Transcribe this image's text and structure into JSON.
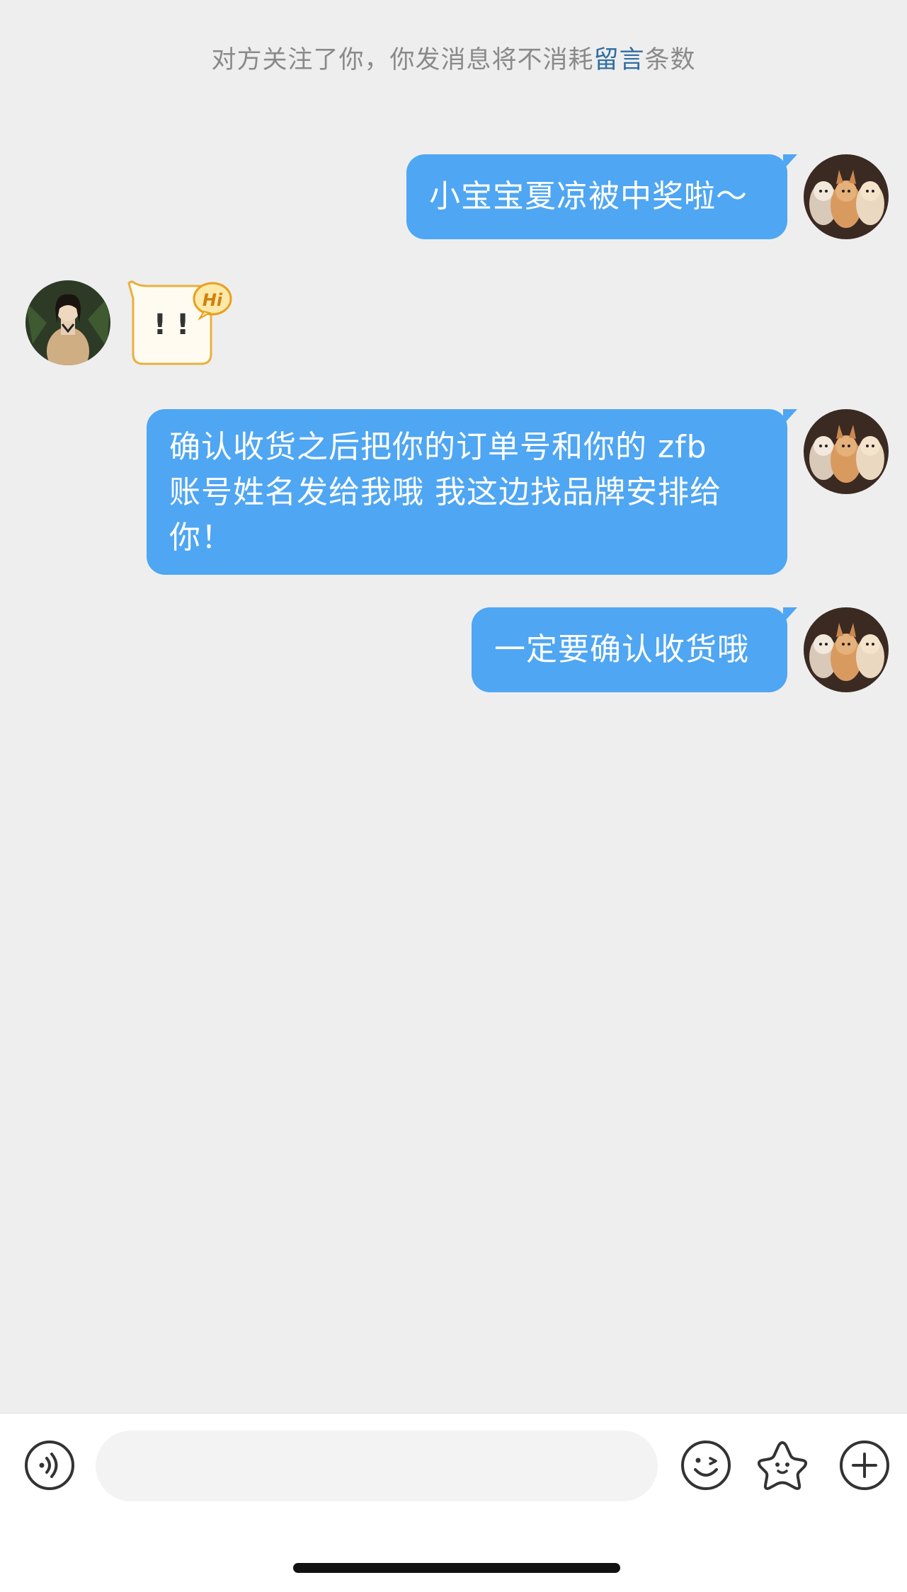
{
  "notice": {
    "prefix": "对方关注了你，你发消息将不消耗",
    "link": "留言",
    "suffix": "条数"
  },
  "messages": [
    {
      "side": "outgoing",
      "text": "小宝宝夏凉被中奖啦～"
    },
    {
      "side": "incoming",
      "sticker_text": "! !",
      "badge": "Hi"
    },
    {
      "side": "outgoing",
      "lines": [
        "确认收货之后把你的订单号和你的 zfb",
        "账号姓名发给我哦 我这边找品牌安排给",
        "你！"
      ]
    },
    {
      "side": "outgoing",
      "text": "一定要确认收货哦"
    }
  ],
  "input_bar": {
    "placeholder": "",
    "icons": [
      "voice-icon",
      "emoji-icon",
      "sticker-star-icon",
      "plus-icon"
    ]
  },
  "colors": {
    "background": "#eeeeee",
    "outgoing_bubble": "#4fa6f2",
    "notice_text": "#8a8a8a",
    "notice_link": "#2f6ea3",
    "sticker_fill": "#fffbf0",
    "sticker_border": "#e8b040"
  }
}
